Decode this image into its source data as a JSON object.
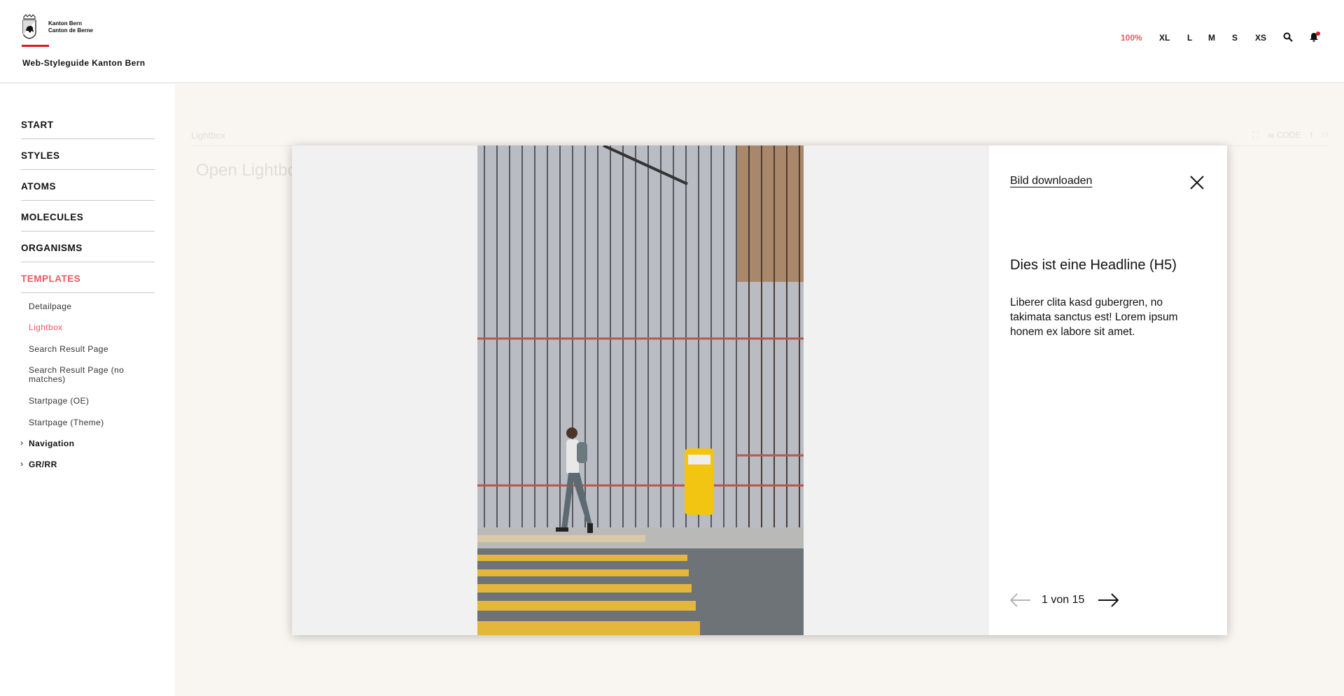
{
  "header": {
    "logo_line1": "Kanton Bern",
    "logo_line2": "Canton de Berne",
    "site_title": "Web-Styleguide Kanton Bern",
    "zoom_options": [
      "100%",
      "XL",
      "L",
      "M",
      "S",
      "XS"
    ],
    "active_zoom": "100%",
    "icons": [
      "search-icon",
      "bell-icon"
    ],
    "accent_color": "#e85a5f"
  },
  "sidebar": {
    "main_items": [
      "START",
      "STYLES",
      "ATOMS",
      "MOLECULES",
      "ORGANISMS",
      "TEMPLATES"
    ],
    "active_main": "TEMPLATES",
    "sub_items": [
      "Detailpage",
      "Lightbox",
      "Search Result Page",
      "Search Result Page (no matches)",
      "Startpage (OE)",
      "Startpage (Theme)"
    ],
    "active_sub": "Lightbox",
    "groups": [
      "Navigation",
      "GR/RR"
    ]
  },
  "page": {
    "title": "Lightbox",
    "open_button": "Open Lightbox",
    "toolbar_code": "CODE"
  },
  "lightbox": {
    "download_label": "Bild downloaden",
    "headline": "Dies ist eine Headline (H5)",
    "body": "Liberer clita kasd gubergren, no takimata sanctus est! Lorem ipsum honem ex labore sit amet.",
    "counter": "1 von 15"
  }
}
